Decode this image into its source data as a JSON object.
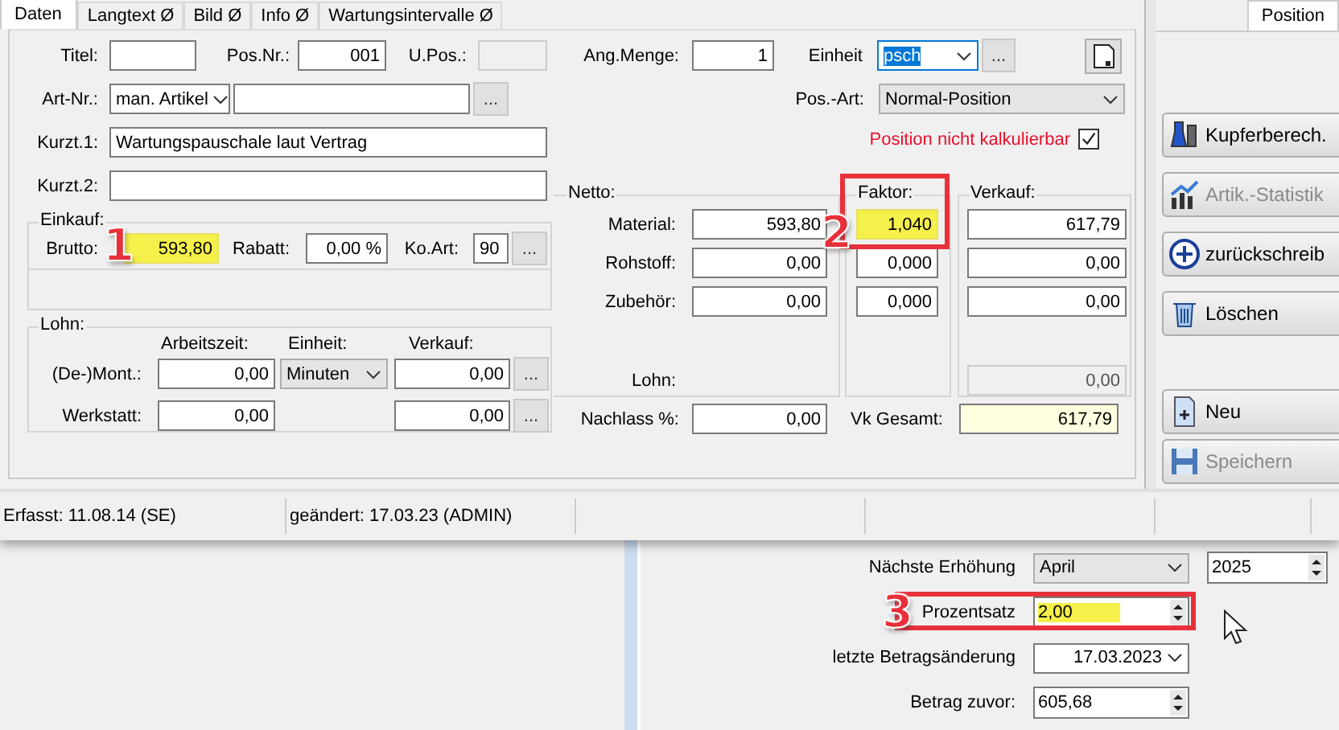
{
  "tabs": [
    {
      "label": "Daten",
      "selected": true
    },
    {
      "label": "Langtext Ø",
      "selected": false
    },
    {
      "label": "Bild Ø",
      "selected": false
    },
    {
      "label": "Info Ø",
      "selected": false
    },
    {
      "label": "Wartungsintervalle Ø",
      "selected": false
    }
  ],
  "side_tab": {
    "label": "Position",
    "selected": true
  },
  "side_buttons": [
    {
      "label": "Kupferberech.",
      "kind": "flask",
      "disabled": false
    },
    {
      "label": "Artik.-Statistik",
      "kind": "chart",
      "disabled": true
    },
    {
      "label": "zurückschreib",
      "kind": "plus",
      "disabled": false
    },
    {
      "label": "Löschen",
      "kind": "trash",
      "disabled": false
    },
    {
      "label": "Neu",
      "kind": "new",
      "disabled": false
    },
    {
      "label": "Speichern",
      "kind": "save",
      "disabled": true
    }
  ],
  "head": {
    "titel": {
      "label": "Titel:"
    },
    "pos_nr": {
      "label": "Pos.Nr.:",
      "value": "001"
    },
    "u_pos": {
      "label": "U.Pos.:",
      "disabled": true
    },
    "ang_menge": {
      "label": "Ang.Menge:",
      "value": "1"
    },
    "einheit": {
      "label": "Einheit",
      "value": "psch",
      "selected": true
    },
    "art_nr": {
      "label": "Art-Nr.:",
      "value": "man. Artikel"
    },
    "pos_art": {
      "label": "Pos.-Art:",
      "value": "Normal-Position"
    },
    "kurzt1": {
      "label": "Kurzt.1:",
      "value": "Wartungspauschale laut Vertrag"
    },
    "kurzt2": {
      "label": "Kurzt.2:"
    },
    "kalkulierbar": {
      "label": "Position nicht kalkulierbar",
      "checked": true
    }
  },
  "einkauf": {
    "title": "Einkauf:",
    "brutto": {
      "label": "Brutto:",
      "value": "593,80",
      "highlighted": true,
      "annotation": "1"
    },
    "rabatt": {
      "label": "Rabatt:",
      "value": "0,00 %"
    },
    "ko_art": {
      "label": "Ko.Art:",
      "value": "90"
    }
  },
  "lohn": {
    "title": "Lohn:",
    "columns": [
      "Arbeitszeit:",
      "Einheit:",
      "Verkauf:"
    ],
    "rows": [
      {
        "label": "(De-)Mont.:",
        "arbeitszeit": "0,00",
        "einheit": "Minuten",
        "verkauf": "0,00"
      },
      {
        "label": "Werkstatt:",
        "arbeitszeit": "0,00",
        "verkauf": "0,00"
      }
    ]
  },
  "kalkulation": {
    "netto_title": "Netto:",
    "faktor_title": "Faktor:",
    "faktor_annotation": "2",
    "verkauf_title": "Verkauf:",
    "rows": [
      {
        "label": "Material:",
        "netto": "593,80",
        "faktor": "1,040",
        "faktor_highlighted": true,
        "verkauf": "617,79"
      },
      {
        "label": "Rohstoff:",
        "netto": "0,00",
        "faktor": "0,000",
        "faktor_highlighted": false,
        "verkauf": "0,00"
      },
      {
        "label": "Zubehör:",
        "netto": "0,00",
        "faktor": "0,000",
        "faktor_highlighted": false,
        "verkauf": "0,00"
      }
    ],
    "lohn": {
      "label": "Lohn:",
      "verkauf": "0,00"
    },
    "nachlass": {
      "label": "Nachlass %:",
      "value": "0,00"
    },
    "vk_gesamt": {
      "label": "Vk Gesamt:",
      "value": "617,79"
    }
  },
  "browse_label": "...",
  "status_bar": [
    "Erfasst: 11.08.14 (SE)",
    "geändert: 17.03.23 (ADMIN)"
  ],
  "erhoehung": {
    "naechste": {
      "label": "Nächste Erhöhung",
      "month": "April",
      "year": "2025"
    },
    "prozentsatz": {
      "label": "Prozentsatz",
      "value": "2,00",
      "highlighted": true,
      "annotation": "3"
    },
    "letzte": {
      "label": "letzte Betragsänderung",
      "value": "17.03.2023"
    },
    "betrag_zuvor": {
      "label": "Betrag zuvor:",
      "value": "605,68"
    }
  }
}
